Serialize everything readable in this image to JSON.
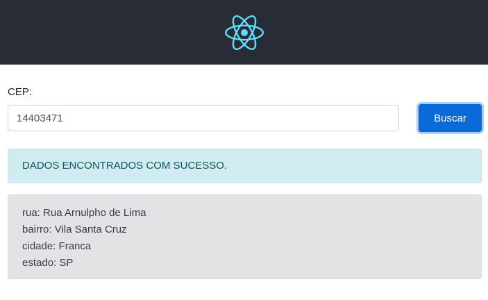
{
  "header": {
    "logo_icon": "react-logo-icon",
    "background_color": "#282c34",
    "logo_color": "#61dafb"
  },
  "form": {
    "cep_label": "CEP:",
    "cep_value": "14403471",
    "search_button_label": "Buscar"
  },
  "alert": {
    "message": "DADOS ENCONTRADOS COM SUCESSO."
  },
  "address": {
    "street": "rua: Rua Arnulpho de Lima",
    "neighborhood": "bairro: Vila Santa Cruz",
    "city": "cidade: Franca",
    "state": "estado: SP"
  }
}
